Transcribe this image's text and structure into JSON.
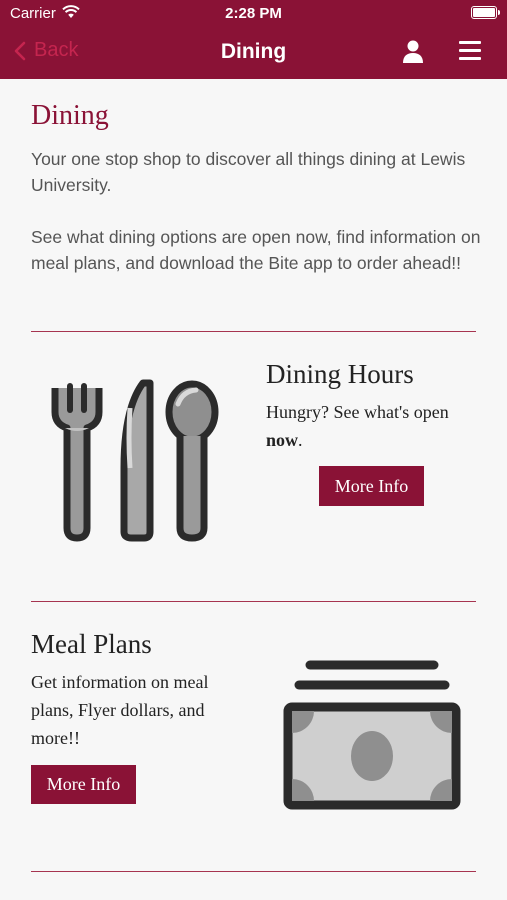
{
  "status_bar": {
    "carrier": "Carrier",
    "time": "2:28 PM"
  },
  "nav": {
    "back_label": "Back",
    "title": "Dining"
  },
  "page": {
    "heading": "Dining",
    "intro_1": "Your one stop shop to discover all things dining at Lewis University.",
    "intro_2": "See what dining options are open now, find information on meal plans, and download the Bite app to order ahead!!"
  },
  "dining_hours": {
    "title": "Dining Hours",
    "text_before": "Hungry? See what's open ",
    "text_bold": "now",
    "text_after": ".",
    "button": "More Info"
  },
  "meal_plans": {
    "title": "Meal Plans",
    "text": "Get information on meal plans, Flyer dollars, and more!!",
    "button": "More Info"
  },
  "colors": {
    "brand": "#8a1236",
    "back_text": "#c5254f",
    "divider": "#a63450"
  },
  "icons": [
    "wifi-icon",
    "battery-icon",
    "chevron-left-icon",
    "user-icon",
    "menu-icon",
    "utensils-icon",
    "money-icon"
  ]
}
